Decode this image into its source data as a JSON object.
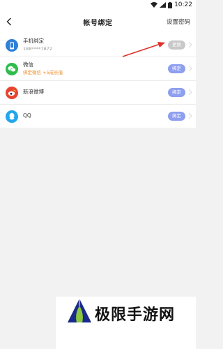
{
  "status_bar": {
    "time": "10:22"
  },
  "header": {
    "title": "帐号绑定",
    "action": "设置密码"
  },
  "bindings": [
    {
      "name": "手机绑定",
      "detail": "188****7872",
      "button": "更换",
      "button_color": "#c8c8c8",
      "icon": "phone-icon",
      "icon_color": "#2d7fd8"
    },
    {
      "name": "微信",
      "detail": "绑定微信 +5成长值",
      "button": "绑定",
      "button_color": "#8e9ff0",
      "icon": "wechat-icon",
      "icon_color": "#2ebd4c"
    },
    {
      "name": "新浪微博",
      "detail": "",
      "button": "绑定",
      "button_color": "#8e9ff0",
      "icon": "weibo-icon",
      "icon_color": "#e8432f"
    },
    {
      "name": "QQ",
      "detail": "",
      "button": "绑定",
      "button_color": "#8e9ff0",
      "icon": "qq-icon",
      "icon_color": "#23a6ed"
    }
  ],
  "watermark": {
    "text": "极限手游网"
  }
}
